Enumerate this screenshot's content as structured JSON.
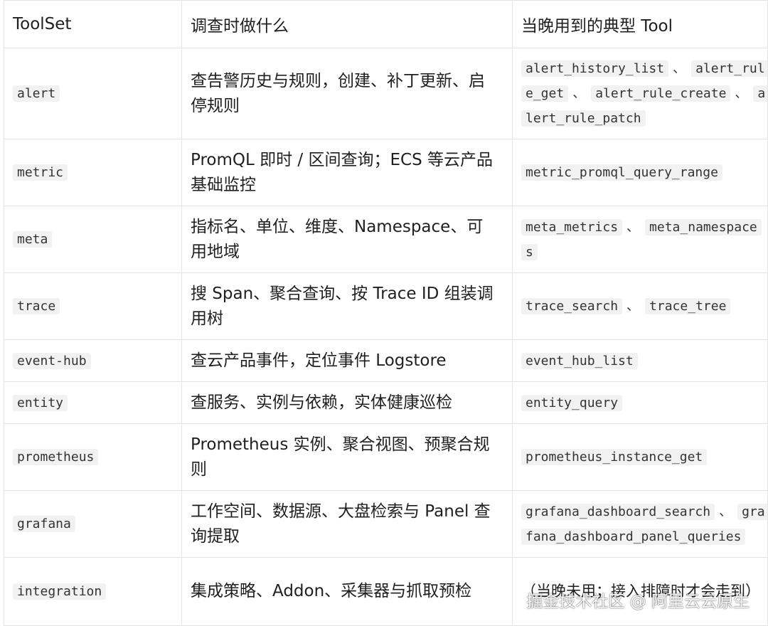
{
  "headers": [
    "ToolSet",
    "调查时做什么",
    "当晚用到的典型 Tool"
  ],
  "separator": "、",
  "rows": [
    {
      "toolset": "alert",
      "desc": "查告警历史与规则，创建、补丁更新、启停规则",
      "height": 128,
      "tools": [
        "alert_history_list",
        "alert_rule_get",
        "alert_rule_create",
        "alert_rule_patch"
      ]
    },
    {
      "toolset": "metric",
      "desc": "PromQL 即时 / 区间查询；ECS 等云产品基础监控",
      "height": 94,
      "tools": [
        "metric_promql_query_range"
      ]
    },
    {
      "toolset": "meta",
      "desc": "指标名、单位、维度、Namespace、可用地域",
      "height": 94,
      "tools": [
        "meta_metrics",
        "meta_namespaces"
      ]
    },
    {
      "toolset": "trace",
      "desc": "搜 Span、聚合查询、按 Trace ID 组装调用树",
      "height": 94,
      "tools": [
        "trace_search",
        "trace_tree"
      ]
    },
    {
      "toolset": "event-hub",
      "desc": "查云产品事件，定位事件 Logstore",
      "height": 59,
      "tools": [
        "event_hub_list"
      ]
    },
    {
      "toolset": "entity",
      "desc": "查服务、实例与依赖，实体健康巡检",
      "height": 59,
      "tools": [
        "entity_query"
      ]
    },
    {
      "toolset": "prometheus",
      "desc": "Prometheus 实例、聚合视图、预聚合规则",
      "height": 94,
      "tools": [
        "prometheus_instance_get"
      ]
    },
    {
      "toolset": "grafana",
      "desc": "工作空间、数据源、大盘检索与 Panel 查询提取",
      "height": 94,
      "tools": [
        "grafana_dashboard_search",
        "grafana_dashboard_panel_queries"
      ]
    },
    {
      "toolset": "integration",
      "desc": "集成策略、Addon、采集器与抓取预检",
      "height": 96,
      "plain": "（当晚未用；接入排障时才会走到）"
    }
  ],
  "watermark": "掘金技术社区 @ 阿里云云原生"
}
